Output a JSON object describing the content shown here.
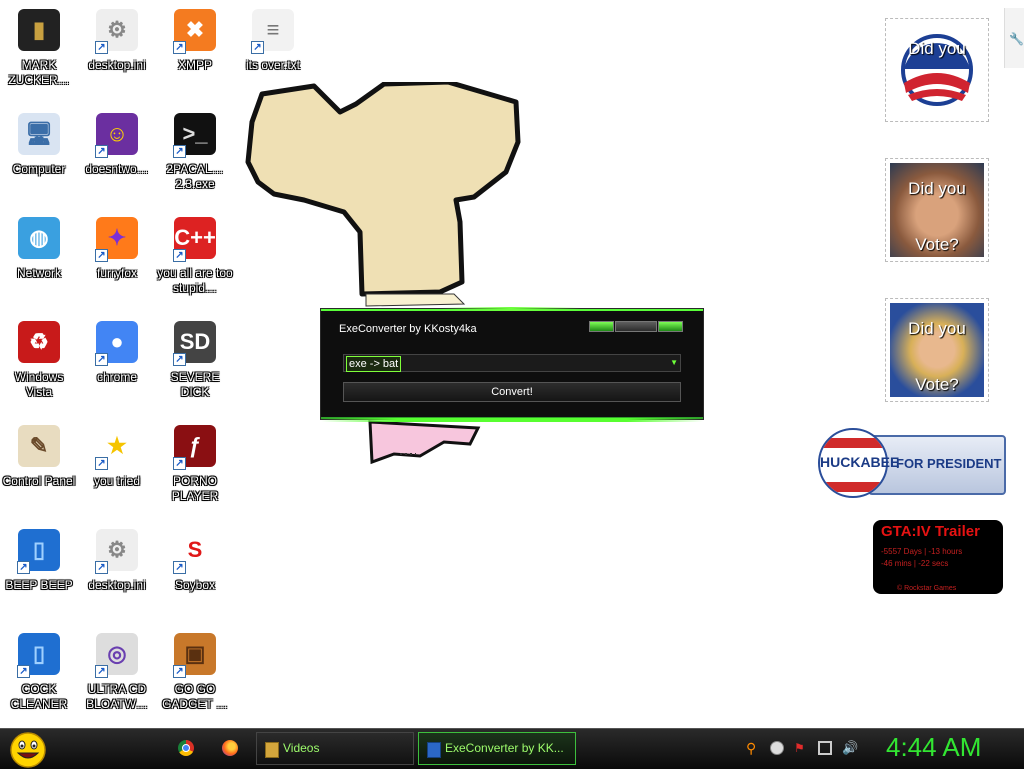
{
  "desktop_icons": [
    {
      "label": "MARK ZUCKER…",
      "icon": "book-icon"
    },
    {
      "label": "desktop.ini",
      "icon": "settings-file-icon"
    },
    {
      "label": "XMPP",
      "icon": "xampp-icon"
    },
    {
      "label": "its over.txt",
      "icon": "text-file-icon"
    },
    {
      "label": "Computer",
      "icon": "computer-icon"
    },
    {
      "label": "doesntwo…",
      "icon": "yahoo-messenger-icon"
    },
    {
      "label": "2PACAL… 2.3.exe",
      "icon": "console-icon"
    },
    {
      "label": "Network",
      "icon": "network-globe-icon"
    },
    {
      "label": "furryfox",
      "icon": "firefox-icon"
    },
    {
      "label": "you all are too stupid…",
      "icon": "devcpp-icon"
    },
    {
      "label": "Windows Vista",
      "icon": "recycle-bin-icon"
    },
    {
      "label": "chrome",
      "icon": "chrome-icon"
    },
    {
      "label": "SEVERE DICK",
      "icon": "sd-drive-icon"
    },
    {
      "label": "Control Panel",
      "icon": "control-panel-icon"
    },
    {
      "label": "you tried",
      "icon": "star-icon"
    },
    {
      "label": "PORNO PLAYER",
      "icon": "flash-icon"
    },
    {
      "label": "BEEP BEEP",
      "icon": "blue-book-icon"
    },
    {
      "label": "desktop.ini",
      "icon": "settings-file-icon"
    },
    {
      "label": "Soybox",
      "icon": "soybox-icon"
    },
    {
      "label": "COCK CLEANER",
      "icon": "blue-book-icon"
    },
    {
      "label": "ULTRA CD BLOATW…",
      "icon": "cd-icon"
    },
    {
      "label": "GO GO GADGET …",
      "icon": "briefcase-icon"
    }
  ],
  "app_window": {
    "title": "ExeConverter by KKosty4ka",
    "combo_value": "exe -> bat",
    "convert_label": "Convert!"
  },
  "gadgets": {
    "poster_1_question": "Did you",
    "poster_2_question": "Did you",
    "poster_2_answer": "Vote?",
    "poster_3_question": "Did you",
    "poster_3_answer": "Vote?",
    "huckabee_name": "HUCKABEE",
    "huckabee_tagline": "FOR PRESIDENT",
    "gta_title": "GTA:IV Trailer",
    "gta_line1": "-5557 Days | -13 hours",
    "gta_line2": "-46 mins | -22 secs",
    "gta_footer": "© Rockstar Games"
  },
  "taskbar": {
    "tasks": [
      {
        "label": "Videos"
      },
      {
        "label": "ExeConverter by KK..."
      }
    ],
    "clock": "4:44 AM"
  },
  "colors": {
    "accent_green": "#32e632",
    "window_bg": "#0e0e0e",
    "gta_red": "#e61212"
  }
}
